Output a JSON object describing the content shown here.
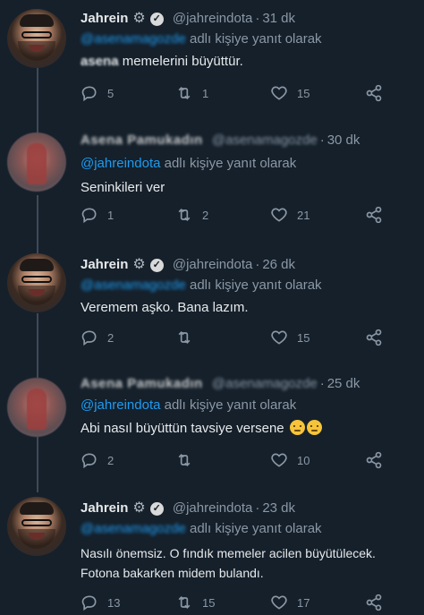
{
  "tweets": [
    {
      "author_name": "Jahrein",
      "handle": "@jahreindota",
      "time": "31 dk",
      "reply_prefix": "",
      "reply_to": "@asenamagozde",
      "reply_suffix": "adlı kişiye yanıt olarak",
      "lines": [
        "memelerini büyüttür."
      ],
      "blur_prefix": "asena",
      "replies": "5",
      "retweets": "1",
      "likes": "15"
    },
    {
      "author_name": "Asena Pamukadın",
      "handle": "@asenamagozde",
      "time": "30 dk",
      "reply_to": "@jahreindota",
      "reply_suffix": "adlı kişiye yanıt olarak",
      "lines": [
        "Seninkileri ver"
      ],
      "replies": "1",
      "retweets": "2",
      "likes": "21"
    },
    {
      "author_name": "Jahrein",
      "handle": "@jahreindota",
      "time": "26 dk",
      "reply_to": "@asenamagozde",
      "reply_suffix": "adlı kişiye yanıt olarak",
      "lines": [
        "Veremem aşko. Bana lazım."
      ],
      "replies": "2",
      "retweets": "",
      "likes": "15"
    },
    {
      "author_name": "Asena Pamukadın",
      "handle": "@asenamagozde",
      "time": "25 dk",
      "reply_to": "@jahreindota",
      "reply_suffix": "adlı kişiye yanıt olarak",
      "lines": [
        "Abi nasıl büyüttün tavsiye versene"
      ],
      "replies": "2",
      "retweets": "",
      "likes": "10"
    },
    {
      "author_name": "Jahrein",
      "handle": "@jahreindota",
      "time": "23 dk",
      "reply_to": "@asenamagozde",
      "reply_suffix": "adlı kişiye yanıt olarak",
      "lines": [
        "Nasılı önemsiz. O fındık memeler acilen büyütülecek.",
        "Fotona bakarken midem bulandı."
      ],
      "replies": "13",
      "retweets": "15",
      "likes": "17"
    }
  ],
  "separator": "·",
  "icons": {
    "reply": "reply-icon",
    "retweet": "retweet-icon",
    "like": "heart-icon",
    "share": "share-icon",
    "settings": "gear-icon",
    "verified": "verified-badge-icon"
  },
  "colors": {
    "background": "#15202b",
    "link": "#1d9bf0",
    "secondary_text": "#8b98a5"
  }
}
